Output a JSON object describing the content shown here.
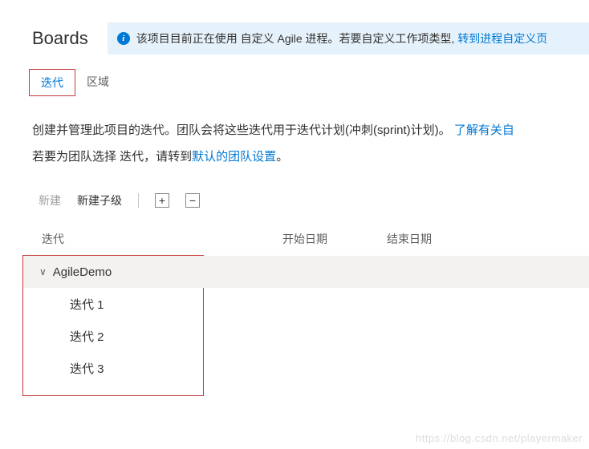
{
  "header": {
    "title": "Boards"
  },
  "banner": {
    "text_before": "该项目目前正在使用 自定义 Agile 进程。若要自定义工作项类型, ",
    "link": "转到进程自定义页"
  },
  "tabs": {
    "iterations": "迭代",
    "areas": "区域"
  },
  "description": {
    "line1_a": "创建并管理此项目的迭代。团队会将这些迭代用于迭代计划(冲刺(sprint)计划)。 ",
    "line1_link": "了解有关自",
    "line2_a": "若要为团队选择 迭代，请转到",
    "line2_link": "默认的团队设置",
    "line2_b": "。"
  },
  "toolbar": {
    "new": "新建",
    "new_child": "新建子级"
  },
  "grid": {
    "col_iteration": "迭代",
    "col_start": "开始日期",
    "col_end": "结束日期"
  },
  "tree": {
    "root": "AgileDemo",
    "children": [
      "迭代 1",
      "迭代 2",
      "迭代 3"
    ]
  },
  "watermark": "https://blog.csdn.net/playermaker"
}
